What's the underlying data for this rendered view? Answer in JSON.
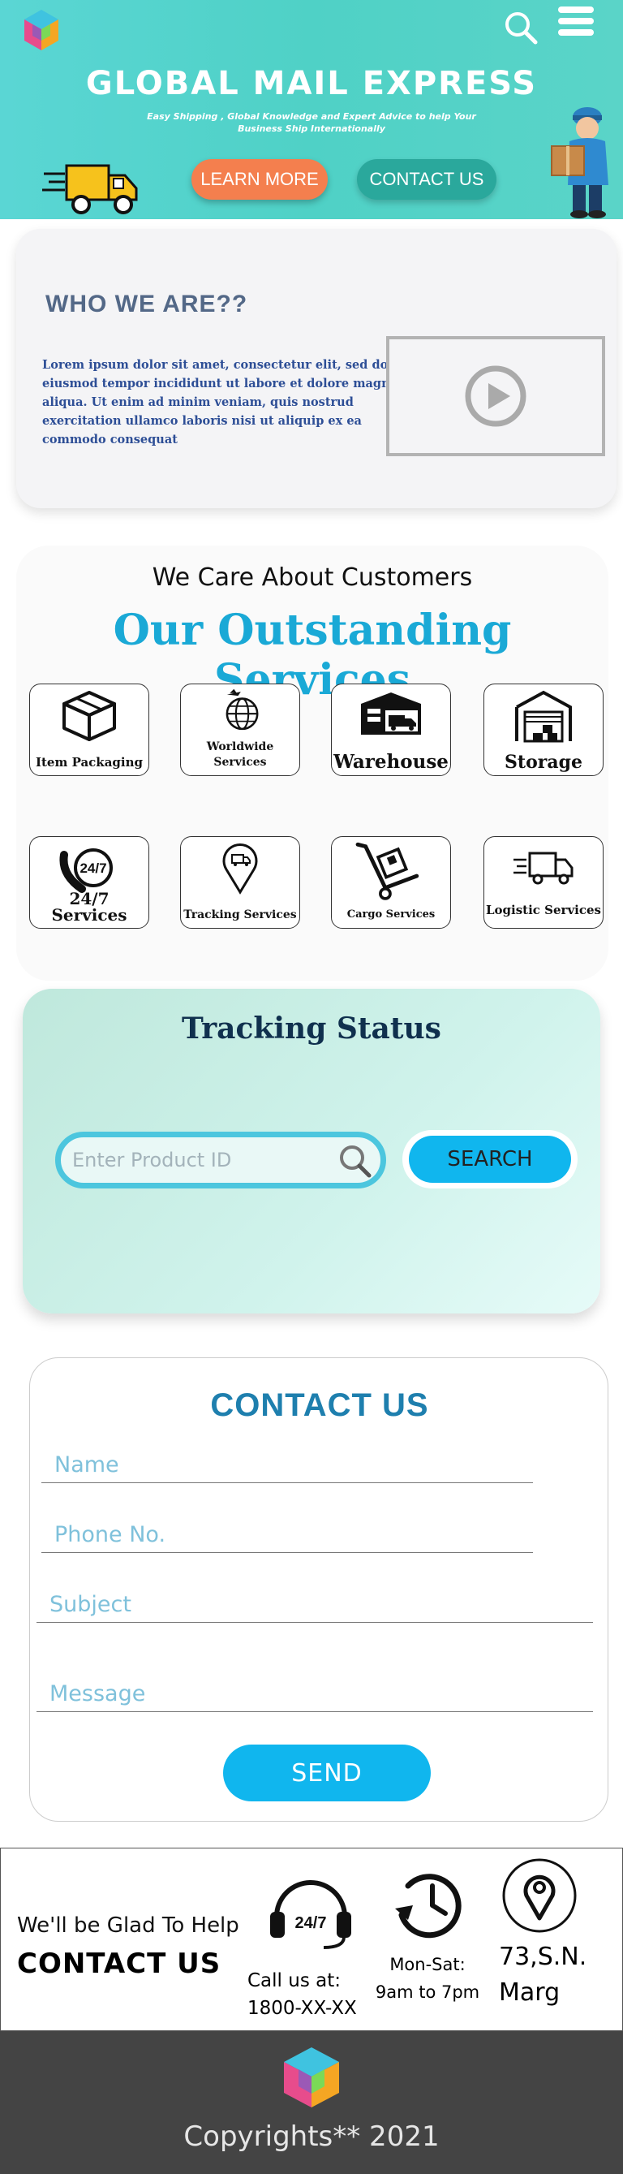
{
  "header": {
    "title": "GLOBAL MAIL EXPRESS",
    "subtitle": "Easy Shipping , Global Knowledge and Expert Advice to help Your Business Ship Internationally",
    "learn_more": "LEARN MORE",
    "contact_us": "CONTACT US"
  },
  "who": {
    "title": "WHO WE ARE??",
    "text": "Lorem ipsum dolor sit amet, consectetur elit, sed do eiusmod tempor incididunt ut labore et dolore magna aliqua. Ut enim ad minim veniam, quis nostrud exercitation ullamco laboris nisi ut aliquip ex ea commodo consequat"
  },
  "services": {
    "tagline": "We Care About Customers",
    "title": "Our Outstanding Services",
    "items": [
      {
        "label": "Item Packaging",
        "icon": "box-icon"
      },
      {
        "label": "Worldwide Services",
        "icon": "globe-plane-icon"
      },
      {
        "label": "Warehouse",
        "icon": "warehouse-truck-icon"
      },
      {
        "label": "Storage",
        "icon": "storage-icon"
      },
      {
        "label": "24/7 Services",
        "icon": "phone-247-icon"
      },
      {
        "label": "Tracking Services",
        "icon": "map-pin-truck-icon"
      },
      {
        "label": "Cargo Services",
        "icon": "hand-truck-icon"
      },
      {
        "label": "Logistic Services",
        "icon": "delivery-truck-icon"
      }
    ]
  },
  "tracking": {
    "title": "Tracking Status",
    "placeholder": "Enter Product ID",
    "button": "SEARCH"
  },
  "contact": {
    "title": "CONTACT US",
    "name_placeholder": "Name",
    "phone_placeholder": "Phone No.",
    "subject_placeholder": "Subject",
    "message_placeholder": "Message",
    "send": "SEND"
  },
  "info": {
    "glad": "We'll be Glad To Help",
    "contact": "CONTACT US",
    "call_line1": "Call us at:",
    "call_line2": "1800-XX-XX",
    "badge": "24/7",
    "hours_line1": "Mon-Sat:",
    "hours_line2": "9am to 7pm",
    "addr_line1": "73,S.N.",
    "addr_line2": "Marg"
  },
  "footer": {
    "copyright": "Copyrights** 2021"
  },
  "colors": {
    "hero": "#4fd1c6",
    "learn": "#f47f4e",
    "contact_btn": "#2aa89c",
    "accent_blue": "#10b6ee",
    "services_title": "#1aa9d6",
    "footer": "#444444"
  }
}
